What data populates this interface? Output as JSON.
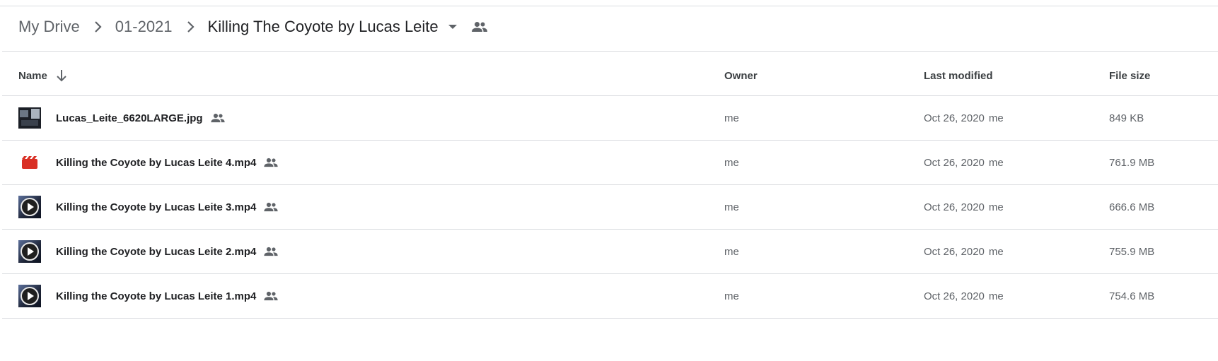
{
  "breadcrumb": {
    "items": [
      "My Drive",
      "01-2021",
      "Killing The Coyote by Lucas Leite"
    ]
  },
  "columns": {
    "name": "Name",
    "owner": "Owner",
    "last_modified": "Last modified",
    "file_size": "File size"
  },
  "files": [
    {
      "name": "Lucas_Leite_6620LARGE.jpg",
      "icon": "image-thumbnail",
      "owner": "me",
      "modified_date": "Oct 26, 2020",
      "modified_by": "me",
      "size": "849 KB"
    },
    {
      "name": "Killing the Coyote by Lucas Leite 4.mp4",
      "icon": "video-file-icon",
      "owner": "me",
      "modified_date": "Oct 26, 2020",
      "modified_by": "me",
      "size": "761.9 MB"
    },
    {
      "name": "Killing the Coyote by Lucas Leite 3.mp4",
      "icon": "video-thumbnail",
      "owner": "me",
      "modified_date": "Oct 26, 2020",
      "modified_by": "me",
      "size": "666.6 MB"
    },
    {
      "name": "Killing the Coyote by Lucas Leite 2.mp4",
      "icon": "video-thumbnail",
      "owner": "me",
      "modified_date": "Oct 26, 2020",
      "modified_by": "me",
      "size": "755.9 MB"
    },
    {
      "name": "Killing the Coyote by Lucas Leite 1.mp4",
      "icon": "video-thumbnail",
      "owner": "me",
      "modified_date": "Oct 26, 2020",
      "modified_by": "me",
      "size": "754.6 MB"
    }
  ],
  "colors": {
    "video_file_red": "#d93025",
    "icon_gray": "#5f6368",
    "divider": "#dadce0"
  }
}
